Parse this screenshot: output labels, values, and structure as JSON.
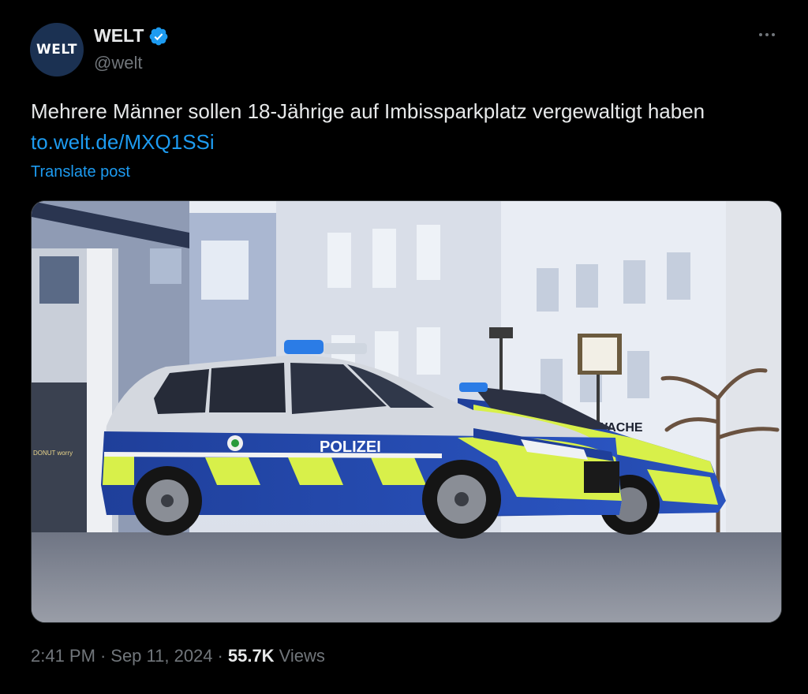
{
  "author": {
    "avatar_text": "WELT",
    "display_name": "WELT",
    "handle": "@welt",
    "verified_icon": "verified-badge-icon",
    "brand_color": "#1b3152"
  },
  "tweet": {
    "text": "Mehrere Männer sollen 18-Jährige auf Imbissparkplatz vergewaltigt haben ",
    "link": "to.welt.de/MXQ1SSi",
    "translate_label": "Translate post",
    "link_color": "#1d9bf0"
  },
  "media": {
    "car_label": "POLIZEI",
    "sign_text": "WACHE",
    "shop_text": "DONUT worry"
  },
  "meta": {
    "time": "2:41 PM",
    "separator": "·",
    "date": "Sep 11, 2024",
    "views_count": "55.7K",
    "views_label": "Views"
  }
}
